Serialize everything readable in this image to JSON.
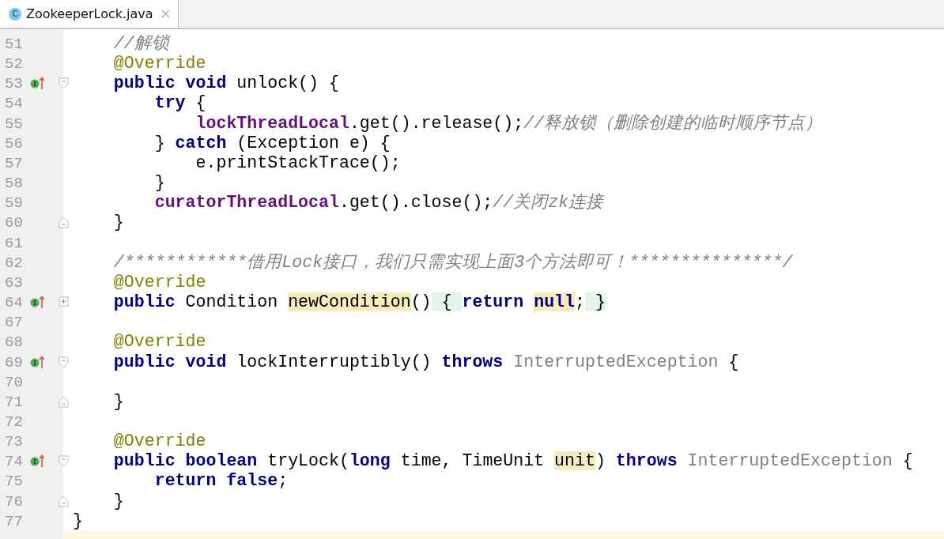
{
  "tabs": [
    {
      "label": "ZookeeperLock.java",
      "icon": "C",
      "selected": true
    }
  ],
  "lines": [
    {
      "number": "51",
      "tokens": [
        {
          "text": "    //解锁",
          "kind": "comment"
        }
      ]
    },
    {
      "number": "52",
      "tokens": [
        {
          "text": "    @Override",
          "kind": "annotation"
        }
      ]
    },
    {
      "number": "53",
      "override": true,
      "fold_marker": {
        "kind": "start"
      },
      "tokens": [
        {
          "text": "    public ",
          "kind": "keyword"
        },
        {
          "text": "void",
          "kind": "keyword"
        },
        {
          "text": " unlock() {",
          "kind": "plain"
        }
      ]
    },
    {
      "number": "54",
      "tokens": [
        {
          "text": "        try",
          "kind": "keyword"
        },
        {
          "text": " {",
          "kind": "plain"
        }
      ]
    },
    {
      "number": "55",
      "tokens": [
        {
          "text": "            lockThreadLocal",
          "kind": "field"
        },
        {
          "text": ".get().release();",
          "kind": "plain"
        },
        {
          "text": "//释放锁（删除创建的临时顺序节点）",
          "kind": "comment"
        }
      ]
    },
    {
      "number": "56",
      "tokens": [
        {
          "text": "        } ",
          "kind": "plain"
        },
        {
          "text": "catch",
          "kind": "keyword"
        },
        {
          "text": " (Exception e) {",
          "kind": "plain"
        }
      ]
    },
    {
      "number": "57",
      "tokens": [
        {
          "text": "            e.printStackTrace();",
          "kind": "plain"
        }
      ]
    },
    {
      "number": "58",
      "tokens": [
        {
          "text": "        }",
          "kind": "plain"
        }
      ]
    },
    {
      "number": "59",
      "tokens": [
        {
          "text": "        curatorThreadLocal",
          "kind": "field"
        },
        {
          "text": ".get().close();",
          "kind": "plain"
        },
        {
          "text": "//关闭zk连接",
          "kind": "comment"
        }
      ]
    },
    {
      "number": "60",
      "fold_marker": {
        "kind": "end"
      },
      "tokens": [
        {
          "text": "    }",
          "kind": "plain"
        }
      ]
    },
    {
      "number": "61"
    },
    {
      "number": "62",
      "tokens": [
        {
          "text": "    /************借用Lock接口，我们只需实现上面3个方法即可！***************/",
          "kind": "comment"
        }
      ]
    },
    {
      "number": "63",
      "tokens": [
        {
          "text": "    @Override",
          "kind": "annotation"
        }
      ]
    },
    {
      "number": "64",
      "override": true,
      "fold_marker": {
        "kind": "collapsed"
      },
      "tokens": [
        {
          "text": "    public",
          "kind": "keyword"
        },
        {
          "text": " Condition ",
          "kind": "plain"
        },
        {
          "text": "newCondition",
          "kind": "plain",
          "usage_highlight": true
        },
        {
          "text": "()",
          "kind": "plain"
        },
        {
          "text": " { ",
          "kind": "plain",
          "folded_region": true
        },
        {
          "text": "return ",
          "kind": "keyword"
        },
        {
          "text": "null",
          "kind": "keyword",
          "usage_highlight": true
        },
        {
          "text": ";",
          "kind": "plain"
        },
        {
          "text": " }",
          "kind": "plain",
          "folded_region": true
        }
      ]
    },
    {
      "number": "67"
    },
    {
      "number": "68",
      "tokens": [
        {
          "text": "    @Override",
          "kind": "annotation"
        }
      ]
    },
    {
      "number": "69",
      "override": true,
      "fold_marker": {
        "kind": "start"
      },
      "tokens": [
        {
          "text": "    public ",
          "kind": "keyword"
        },
        {
          "text": "void",
          "kind": "keyword"
        },
        {
          "text": " lockInterruptibly() ",
          "kind": "plain"
        },
        {
          "text": "throws",
          "kind": "keyword"
        },
        {
          "text": " InterruptedException",
          "kind": "unused"
        },
        {
          "text": " {",
          "kind": "plain"
        }
      ]
    },
    {
      "number": "70"
    },
    {
      "number": "71",
      "fold_marker": {
        "kind": "end"
      },
      "tokens": [
        {
          "text": "    }",
          "kind": "plain"
        }
      ]
    },
    {
      "number": "72"
    },
    {
      "number": "73",
      "tokens": [
        {
          "text": "    @Override",
          "kind": "annotation"
        }
      ]
    },
    {
      "number": "74",
      "override": true,
      "fold_marker": {
        "kind": "start"
      },
      "tokens": [
        {
          "text": "    public ",
          "kind": "keyword"
        },
        {
          "text": "boolean",
          "kind": "keyword"
        },
        {
          "text": " tryLock(",
          "kind": "plain"
        },
        {
          "text": "long",
          "kind": "keyword"
        },
        {
          "text": " time, TimeUnit ",
          "kind": "plain"
        },
        {
          "text": "unit",
          "kind": "plain",
          "usage_highlight": true
        },
        {
          "text": ") ",
          "kind": "plain"
        },
        {
          "text": "throws",
          "kind": "keyword"
        },
        {
          "text": " InterruptedException",
          "kind": "unused"
        },
        {
          "text": " {",
          "kind": "plain"
        }
      ]
    },
    {
      "number": "75",
      "tokens": [
        {
          "text": "        return ",
          "kind": "keyword"
        },
        {
          "text": "false",
          "kind": "keyword"
        },
        {
          "text": ";",
          "kind": "plain"
        }
      ]
    },
    {
      "number": "76",
      "fold_marker": {
        "kind": "end"
      },
      "tokens": [
        {
          "text": "    }",
          "kind": "plain"
        }
      ]
    },
    {
      "number": "77",
      "tokens": [
        {
          "text": "}",
          "kind": "plain"
        }
      ]
    }
  ]
}
